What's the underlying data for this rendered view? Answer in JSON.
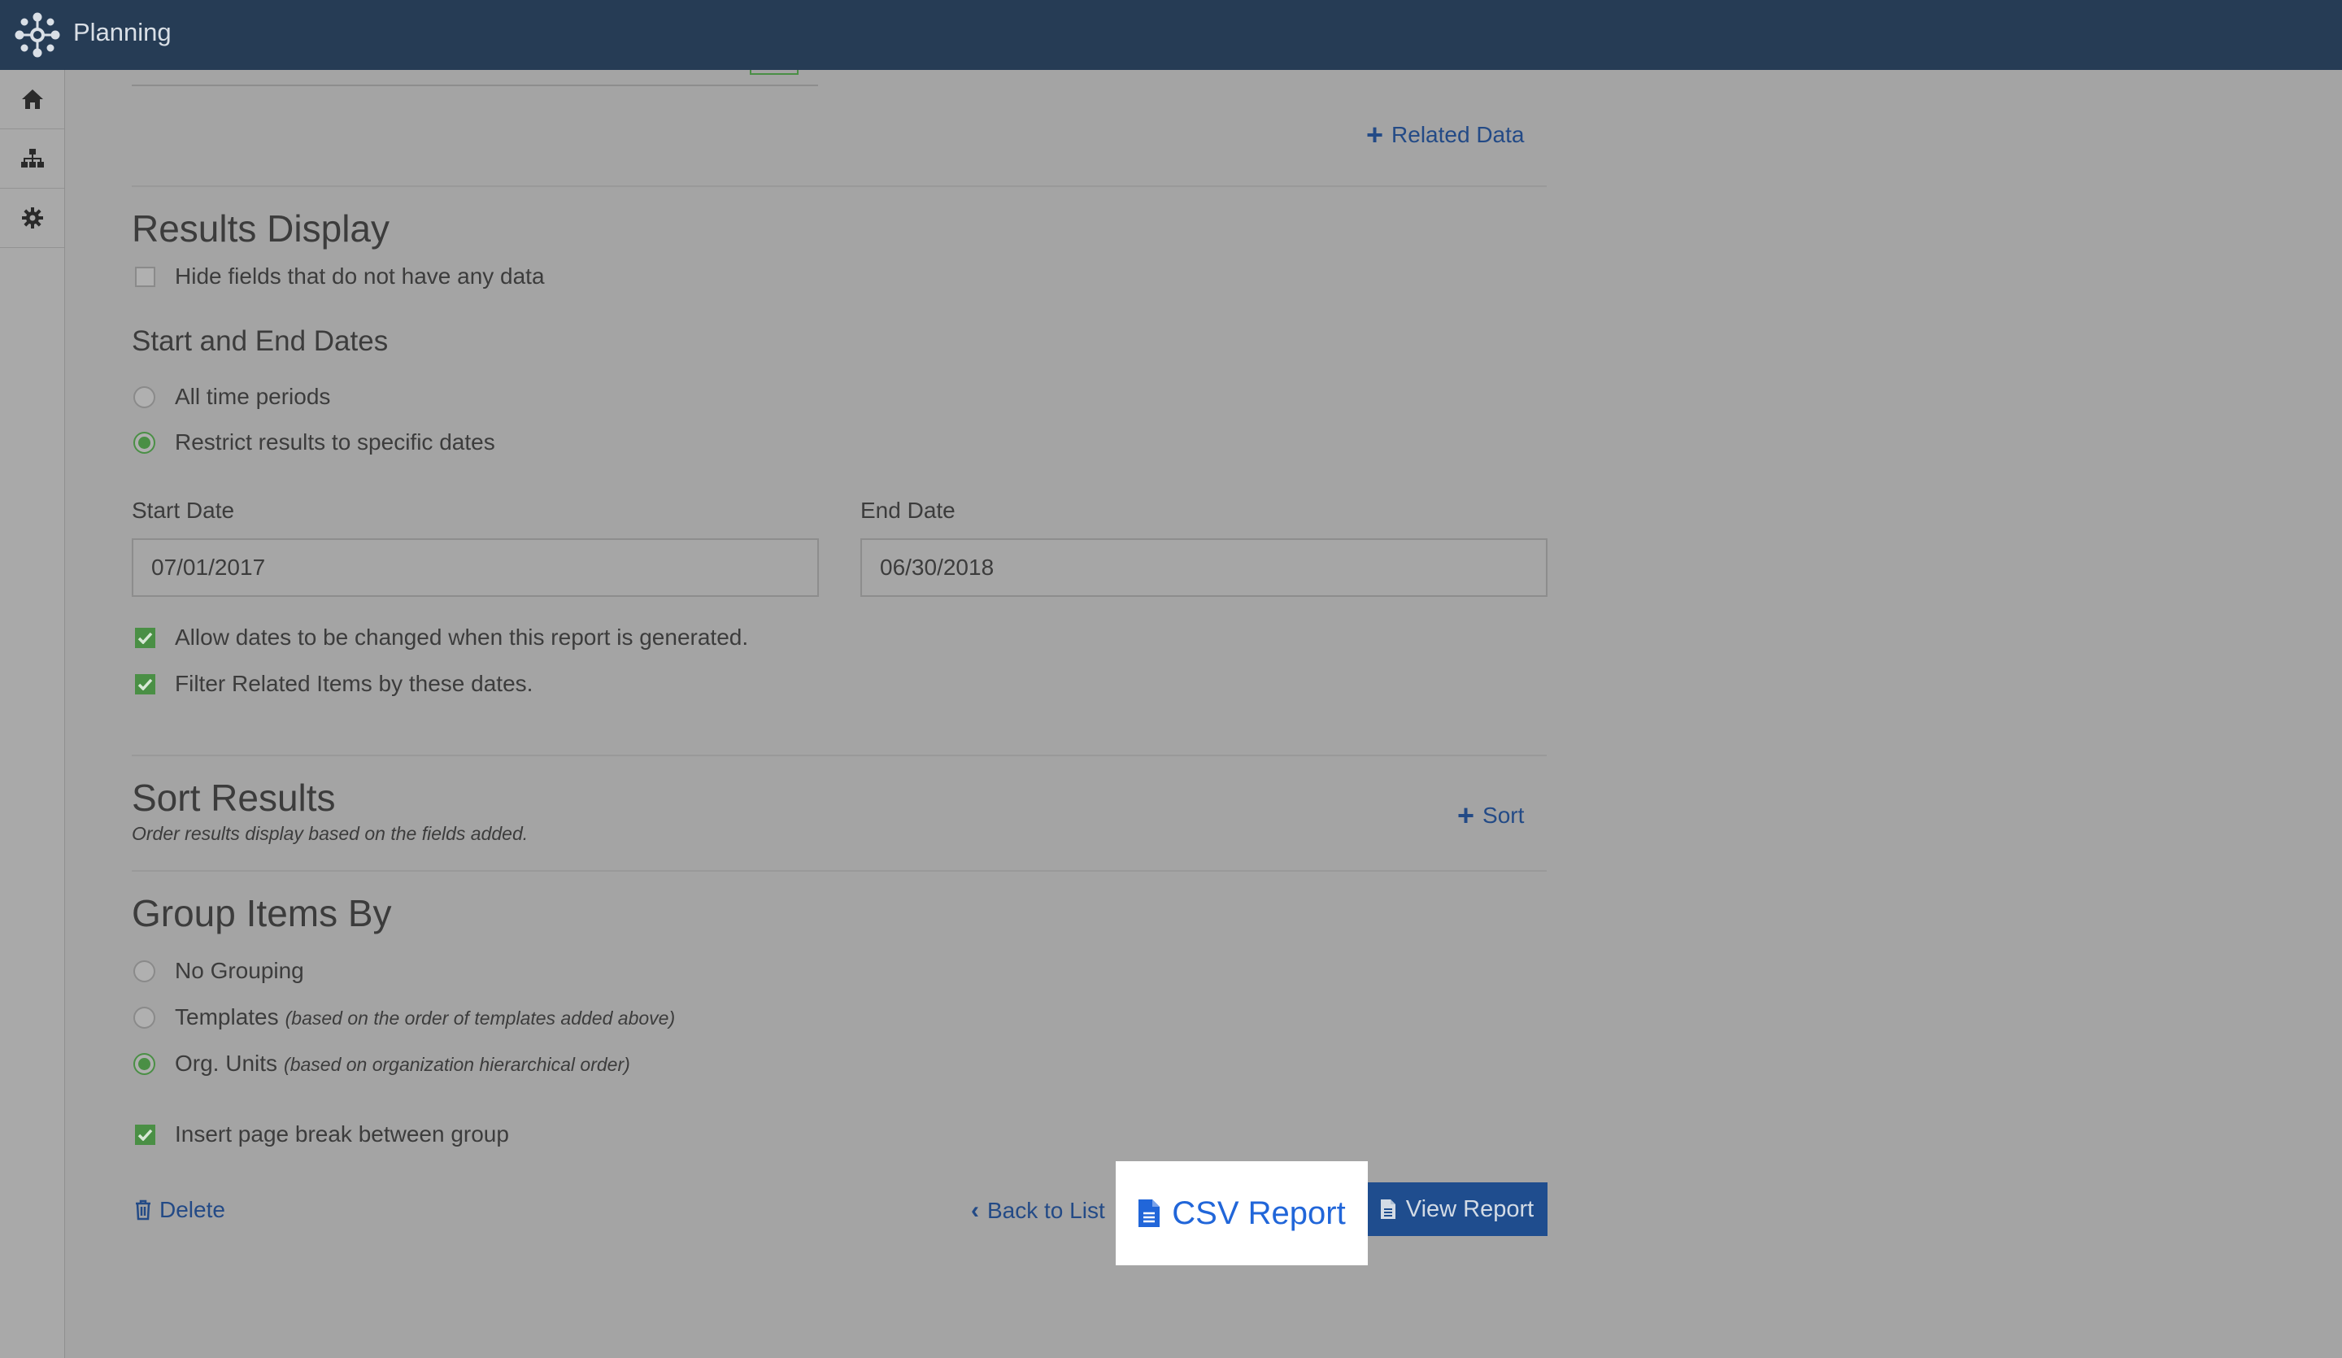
{
  "header": {
    "app_title": "Planning"
  },
  "sidebar": {
    "items": [
      {
        "icon": "home-icon"
      },
      {
        "icon": "sitemap-icon"
      },
      {
        "icon": "gear-icon"
      }
    ]
  },
  "related": {
    "label": "Related Data"
  },
  "results_display": {
    "title": "Results Display",
    "hide_fields_label": "Hide fields that do not have any data",
    "hide_fields_checked": false
  },
  "dates": {
    "title": "Start and End Dates",
    "all_time_label": "All time periods",
    "restrict_label": "Restrict results to specific dates",
    "selected": "restrict",
    "start_label": "Start Date",
    "start_value": "07/01/2017",
    "end_label": "End Date",
    "end_value": "06/30/2018",
    "allow_change_label": "Allow dates to be changed when this report is generated.",
    "allow_change_checked": true,
    "filter_related_label": "Filter Related Items by these dates.",
    "filter_related_checked": true
  },
  "sort": {
    "title": "Sort Results",
    "subtitle": "Order results display based on the fields added.",
    "add_label": "Sort"
  },
  "group": {
    "title": "Group Items By",
    "options": [
      {
        "label": "No Grouping",
        "note": ""
      },
      {
        "label": "Templates",
        "note": "(based on the order of templates added above)"
      },
      {
        "label": "Org. Units",
        "note": "(based on organization hierarchical order)"
      }
    ],
    "selected_index": 2,
    "page_break_label": "Insert page break between group",
    "page_break_checked": true
  },
  "actions": {
    "delete_label": "Delete",
    "back_label": "Back to List",
    "csv_label": "CSV Report",
    "view_label": "View Report"
  },
  "colors": {
    "topbar": "#263c55",
    "accent": "#2166d9",
    "check": "#4a8f45",
    "primary_button": "#1f4d8e"
  }
}
